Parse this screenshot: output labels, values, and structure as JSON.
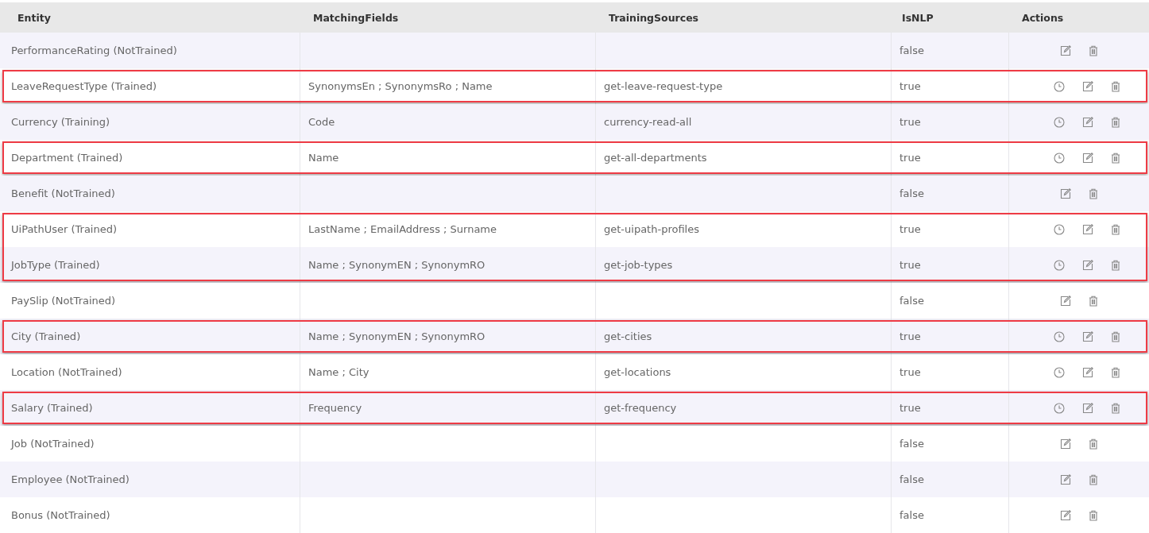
{
  "table": {
    "columns": [
      "Entity",
      "MatchingFields",
      "TrainingSources",
      "IsNLP",
      "Actions"
    ],
    "row_groups": [
      {
        "highlighted": false,
        "rows": [
          {
            "entity": "PerformanceRating (NotTrained)",
            "matching_fields": "",
            "training_sources": "",
            "is_nlp": "false",
            "history": false
          }
        ]
      },
      {
        "highlighted": true,
        "rows": [
          {
            "entity": "LeaveRequestType (Trained)",
            "matching_fields": "SynonymsEn ; SynonymsRo ; Name",
            "training_sources": "get-leave-request-type",
            "is_nlp": "true",
            "history": true
          }
        ]
      },
      {
        "highlighted": false,
        "rows": [
          {
            "entity": "Currency (Training)",
            "matching_fields": "Code",
            "training_sources": "currency-read-all",
            "is_nlp": "true",
            "history": true
          }
        ]
      },
      {
        "highlighted": true,
        "rows": [
          {
            "entity": "Department (Trained)",
            "matching_fields": "Name",
            "training_sources": "get-all-departments",
            "is_nlp": "true",
            "history": true
          }
        ]
      },
      {
        "highlighted": false,
        "rows": [
          {
            "entity": "Benefit (NotTrained)",
            "matching_fields": "",
            "training_sources": "",
            "is_nlp": "false",
            "history": false
          }
        ]
      },
      {
        "highlighted": true,
        "rows": [
          {
            "entity": "UiPathUser (Trained)",
            "matching_fields": "LastName ; EmailAddress ; Surname",
            "training_sources": "get-uipath-profiles",
            "is_nlp": "true",
            "history": true
          },
          {
            "entity": "JobType (Trained)",
            "matching_fields": "Name ; SynonymEN ; SynonymRO",
            "training_sources": "get-job-types",
            "is_nlp": "true",
            "history": true
          }
        ]
      },
      {
        "highlighted": false,
        "rows": [
          {
            "entity": "PaySlip (NotTrained)",
            "matching_fields": "",
            "training_sources": "",
            "is_nlp": "false",
            "history": false
          }
        ]
      },
      {
        "highlighted": true,
        "rows": [
          {
            "entity": "City (Trained)",
            "matching_fields": "Name ; SynonymEN ; SynonymRO",
            "training_sources": "get-cities",
            "is_nlp": "true",
            "history": true
          }
        ]
      },
      {
        "highlighted": false,
        "rows": [
          {
            "entity": "Location (NotTrained)",
            "matching_fields": "Name ; City",
            "training_sources": "get-locations",
            "is_nlp": "true",
            "history": true
          }
        ]
      },
      {
        "highlighted": true,
        "rows": [
          {
            "entity": "Salary (Trained)",
            "matching_fields": "Frequency",
            "training_sources": "get-frequency",
            "is_nlp": "true",
            "history": true
          }
        ]
      },
      {
        "highlighted": false,
        "rows": [
          {
            "entity": "Job (NotTrained)",
            "matching_fields": "",
            "training_sources": "",
            "is_nlp": "false",
            "history": false
          }
        ]
      },
      {
        "highlighted": false,
        "rows": [
          {
            "entity": "Employee (NotTrained)",
            "matching_fields": "",
            "training_sources": "",
            "is_nlp": "false",
            "history": false
          }
        ]
      },
      {
        "highlighted": false,
        "rows": [
          {
            "entity": "Bonus (NotTrained)",
            "matching_fields": "",
            "training_sources": "",
            "is_nlp": "false",
            "history": false
          }
        ]
      }
    ]
  }
}
